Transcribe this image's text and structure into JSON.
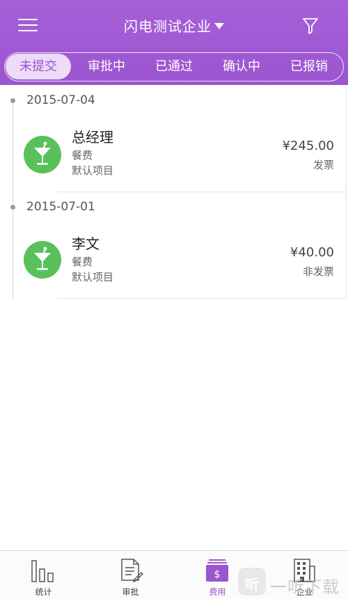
{
  "header": {
    "company_name": "闪电测试企业",
    "menu_icon": "hamburger-menu-icon",
    "filter_icon": "funnel-filter-icon",
    "background_color": "#9b55cf"
  },
  "tabs": [
    {
      "label": "未提交",
      "active": true
    },
    {
      "label": "审批中",
      "active": false
    },
    {
      "label": "已通过",
      "active": false
    },
    {
      "label": "确认中",
      "active": false
    },
    {
      "label": "已报销",
      "active": false
    }
  ],
  "groups": [
    {
      "date": "2015-07-04",
      "items": [
        {
          "name": "总经理",
          "category": "餐费",
          "project": "默认项目",
          "amount": "¥245.00",
          "invoice": "发票",
          "icon": "cocktail-icon"
        }
      ]
    },
    {
      "date": "2015-07-01",
      "items": [
        {
          "name": "李文",
          "category": "餐费",
          "project": "默认项目",
          "amount": "¥40.00",
          "invoice": "非发票",
          "icon": "cocktail-icon"
        }
      ]
    }
  ],
  "bottom_nav": [
    {
      "label": "统计",
      "icon": "bar-chart-icon",
      "active": false
    },
    {
      "label": "审批",
      "icon": "document-edit-icon",
      "active": false
    },
    {
      "label": "费用",
      "icon": "money-stack-icon",
      "active": true
    },
    {
      "label": "企业",
      "icon": "building-icon",
      "active": false
    }
  ],
  "watermark": {
    "badge_text": "听",
    "text": "一听下载"
  },
  "colors": {
    "accent": "#9b55cf",
    "active_tab_bg": "#ecdcf8",
    "avatar_green": "#58c159"
  }
}
